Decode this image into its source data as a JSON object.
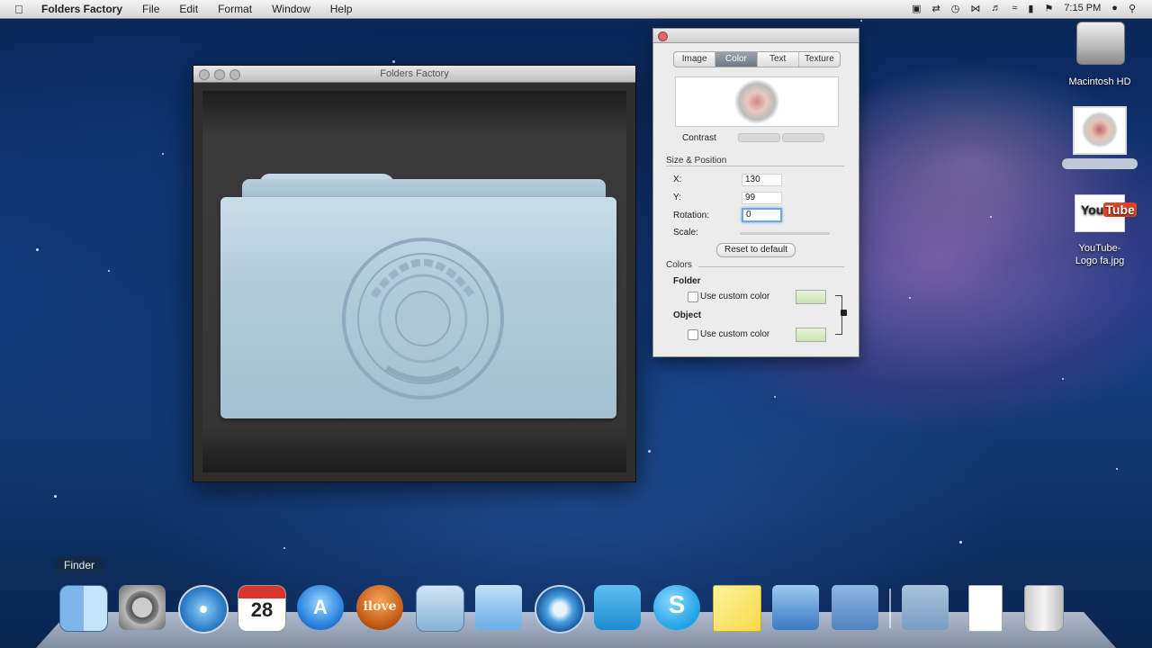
{
  "menubar": {
    "app_name": "Folders Factory",
    "items": [
      "File",
      "Edit",
      "Format",
      "Window",
      "Help"
    ],
    "clock": "7:15 PM"
  },
  "preview_window": {
    "title": "Folders Factory"
  },
  "inspector": {
    "tabs": [
      "Image",
      "Color",
      "Text",
      "Texture"
    ],
    "active_tab": 1,
    "contrast_label": "Contrast",
    "size_position_title": "Size & Position",
    "x_label": "X:",
    "x_value": "130",
    "y_label": "Y:",
    "y_value": "99",
    "rotation_label": "Rotation:",
    "rotation_value": "0",
    "scale_label": "Scale:",
    "reset_label": "Reset to default",
    "colors_title": "Colors",
    "folder_label": "Folder",
    "folder_check_label": "Use custom color",
    "object_label": "Object",
    "object_check_label": "Use custom color"
  },
  "desktop": {
    "hd_label": "Macintosh HD",
    "youtube_label_1": "YouTube-",
    "youtube_label_2": "Logo   fa.jpg"
  },
  "dock": {
    "tooltip": "Finder",
    "calendar_day": "28",
    "ilove_text": "ilove"
  }
}
